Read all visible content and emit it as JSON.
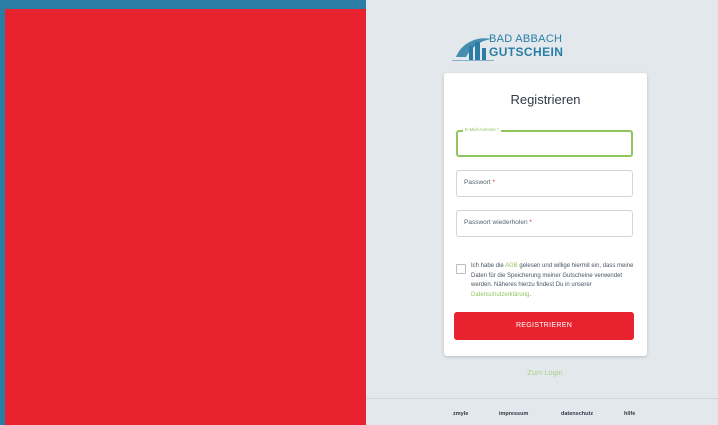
{
  "logo": {
    "line1": "BAD ABBACH",
    "line2": "GUTSCHEIN"
  },
  "card": {
    "title": "Registrieren",
    "email_label": "E-Mail-Adresse",
    "password_label": "Passwort",
    "password_repeat_label": "Passwort wiederholen",
    "required_mark": "*",
    "consent": {
      "part1": "Ich habe die ",
      "agb": "AGB",
      "part2": " gelesen und willige hiermit ein, dass meine Daten für die Speicherung meiner Gutscheine verwendet werden. Näheres hierzu findest Du in unserer ",
      "privacy": "Datenschutzerklärung",
      "part3": "."
    },
    "register_button": "REGISTRIEREN"
  },
  "zum_login": "Zum Login",
  "footer": {
    "zmyle": "zmyle",
    "impressum": "impressum",
    "datenschutz": "datenschutz",
    "hilfe": "hilfe"
  },
  "colors": {
    "brand_red": "#e8232f",
    "brand_blue": "#2a7ea6",
    "accent_green": "#8fc65e"
  }
}
